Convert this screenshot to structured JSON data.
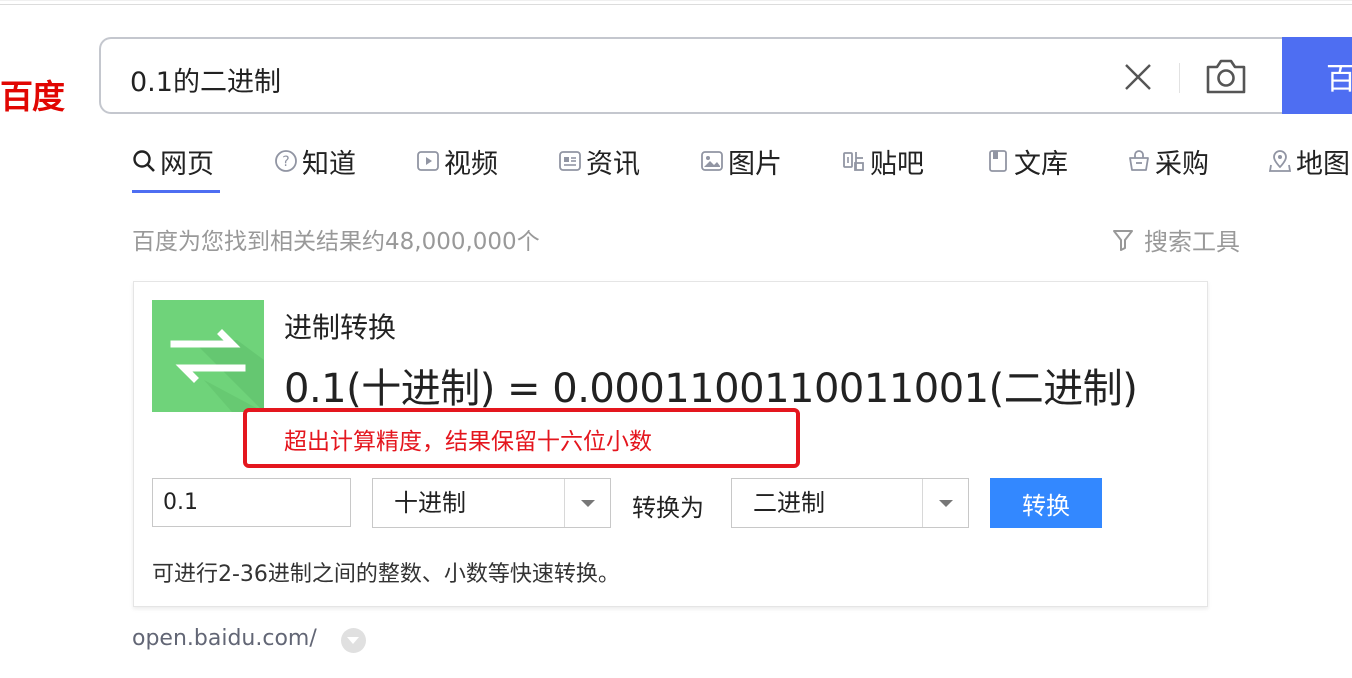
{
  "logo": {
    "text": "百度"
  },
  "search": {
    "query": "0.1的二进制",
    "button_label": "百"
  },
  "tabs": [
    {
      "label": "网页",
      "icon": "search-icon",
      "active": true
    },
    {
      "label": "知道",
      "icon": "question-circle-icon"
    },
    {
      "label": "视频",
      "icon": "video-icon"
    },
    {
      "label": "资讯",
      "icon": "news-icon"
    },
    {
      "label": "图片",
      "icon": "image-icon"
    },
    {
      "label": "贴吧",
      "icon": "tieba-icon"
    },
    {
      "label": "文库",
      "icon": "document-icon"
    },
    {
      "label": "采购",
      "icon": "shopping-basket-icon"
    },
    {
      "label": "地图",
      "icon": "map-icon"
    }
  ],
  "results": {
    "count_text": "百度为您找到相关结果约48,000,000个",
    "search_tools_label": "搜索工具"
  },
  "converter_card": {
    "title": "进制转换",
    "result": "0.1(十进制) = 0.0001100110011001(二进制)",
    "note": "超出计算精度，结果保留十六位小数",
    "input_value": "0.1",
    "from_base": "十进制",
    "convert_to_label": "转换为",
    "to_base": "二进制",
    "convert_button_label": "转换",
    "description": "可进行2-36进制之间的整数、小数等快速转换。",
    "source_url": "open.baidu.com/"
  },
  "colors": {
    "brand_red": "#e10602",
    "brand_blue": "#4e6ef2",
    "convert_blue": "#3388ff",
    "icon_green": "#6fd37a",
    "annotation_red": "#e4161e"
  }
}
